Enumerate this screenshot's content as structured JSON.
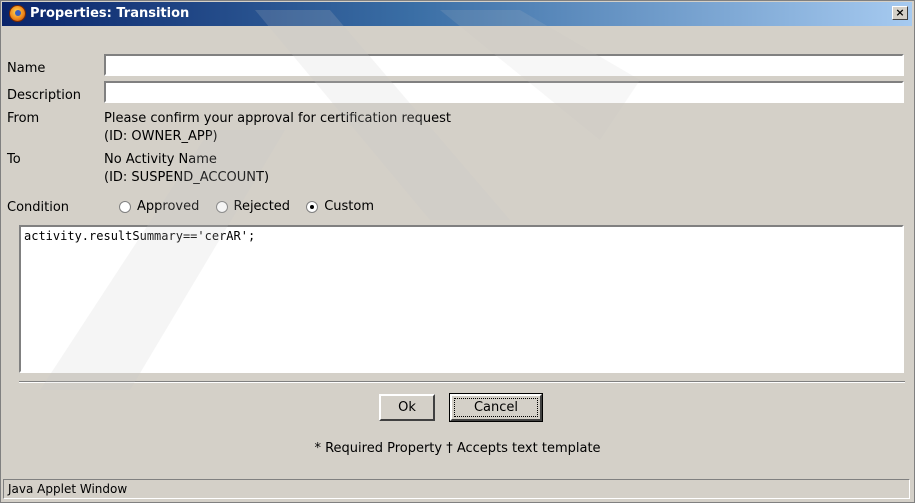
{
  "window": {
    "title": "Properties: Transition",
    "icon": "app-icon",
    "close_glyph": "×"
  },
  "form": {
    "name_label": "Name",
    "name_value": "",
    "description_label": "Description",
    "description_value": "",
    "from_label": "From",
    "from_activity": "Please confirm your approval for certification request",
    "from_id": "(ID: OWNER_APP)",
    "to_label": "To",
    "to_activity": "No Activity Name",
    "to_id": "(ID: SUSPEND_ACCOUNT)",
    "condition_label": "Condition",
    "condition_options": [
      {
        "label": "Approved",
        "selected": false
      },
      {
        "label": "Rejected",
        "selected": false
      },
      {
        "label": "Custom",
        "selected": true
      }
    ],
    "script_value": "activity.resultSummary=='cerAR';"
  },
  "buttons": {
    "ok_label": "Ok",
    "cancel_label": "Cancel"
  },
  "footer": {
    "note": "* Required Property † Accepts text template"
  },
  "statusbar": {
    "text": "Java Applet Window"
  },
  "colors": {
    "title_start": "#0a246a",
    "title_end": "#a6caf0",
    "dialog_bg": "#d4d0c8"
  }
}
